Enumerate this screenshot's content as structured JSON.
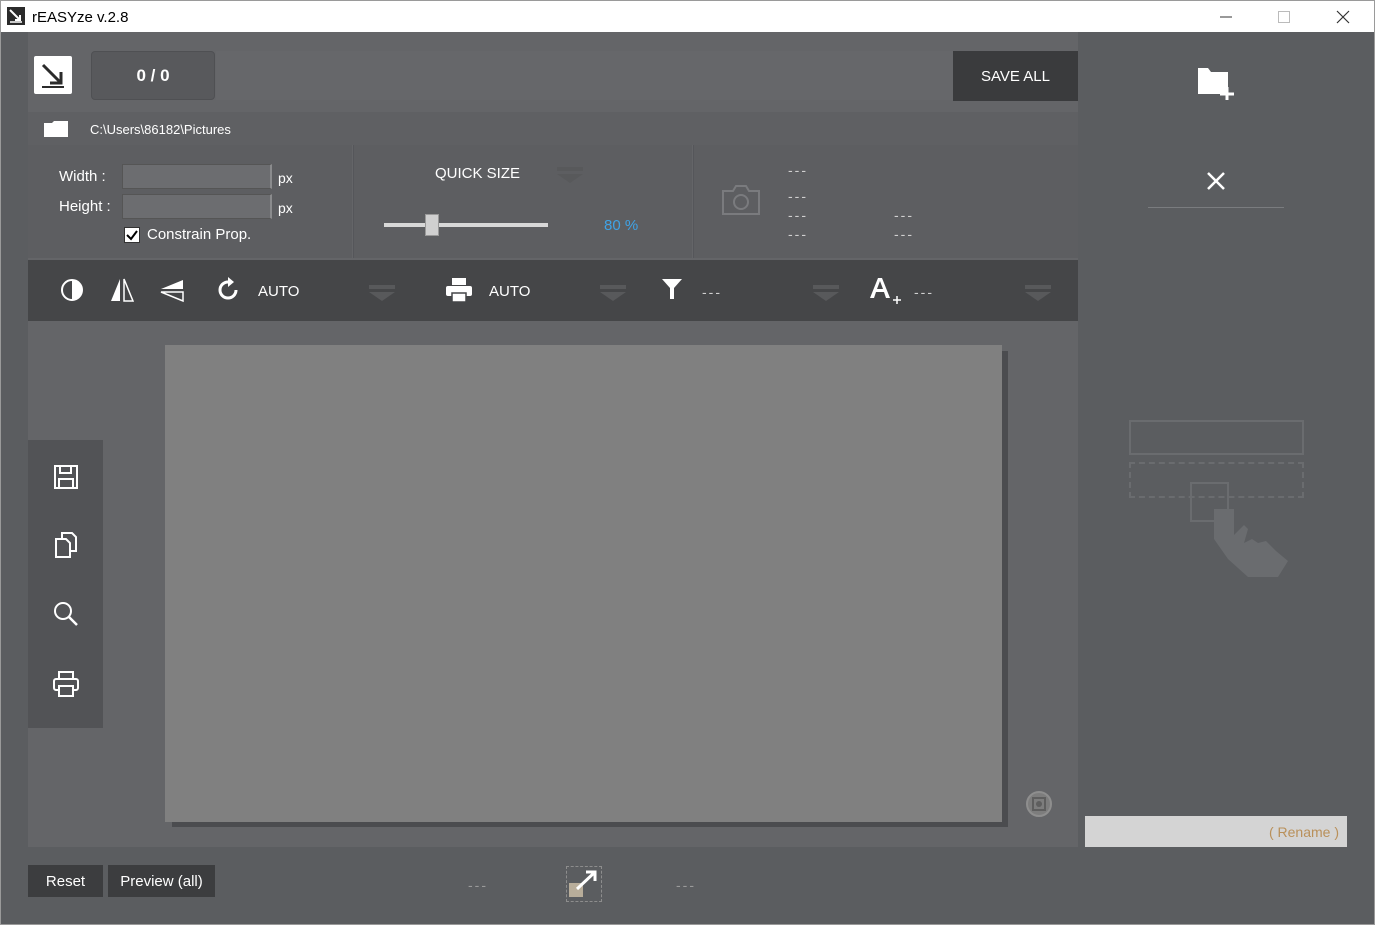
{
  "window": {
    "title": "rEASYze v.2.8",
    "app_icon": "resize-arrow-icon",
    "controls": [
      "minimize-icon",
      "maximize-icon",
      "close-icon"
    ]
  },
  "topbar": {
    "counter": "0 / 0",
    "save_all": "SAVE ALL",
    "path": "C:\\Users\\86182\\Pictures"
  },
  "size_panel": {
    "width_label": "Width :",
    "height_label": "Height :",
    "width_value": "",
    "height_value": "",
    "unit_width": "px",
    "unit_height": "px",
    "constrain_label": "Constrain Prop.",
    "constrain_checked": true
  },
  "quick_size": {
    "label": "QUICK SIZE",
    "percent_label": "80 %",
    "slider_fraction": 0.29
  },
  "exif": {
    "line1": "---",
    "line2": "---",
    "line3a": "---",
    "line3b": "---",
    "line4a": "---",
    "line4b": "---"
  },
  "toolbar": {
    "rotate_value": "AUTO",
    "print_value": "AUTO",
    "filter_value": "---",
    "text_value": "---"
  },
  "bottom": {
    "reset": "Reset",
    "preview_all": "Preview (all)",
    "left_dash": "---",
    "right_dash": "---"
  },
  "right_panel": {
    "rename_placeholder": "( Rename )"
  },
  "colors": {
    "accent_blue": "#3fa3e6",
    "rename_text": "#b9905a",
    "window_bg": "#5b5d60"
  }
}
